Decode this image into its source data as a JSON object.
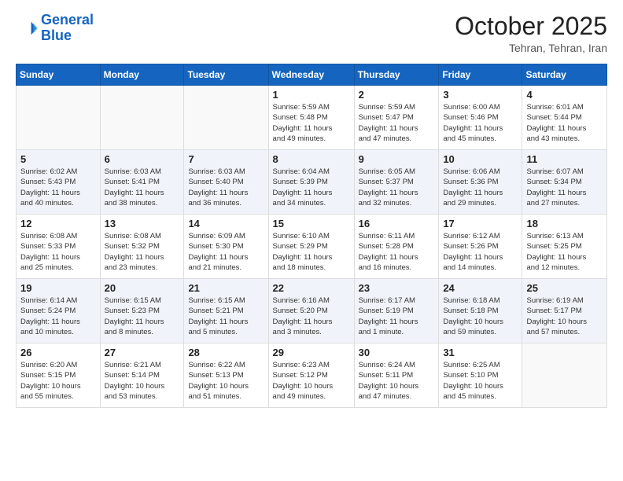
{
  "logo": {
    "line1": "General",
    "line2": "Blue"
  },
  "title": "October 2025",
  "location": "Tehran, Tehran, Iran",
  "weekdays": [
    "Sunday",
    "Monday",
    "Tuesday",
    "Wednesday",
    "Thursday",
    "Friday",
    "Saturday"
  ],
  "weeks": [
    [
      {
        "day": "",
        "info": ""
      },
      {
        "day": "",
        "info": ""
      },
      {
        "day": "",
        "info": ""
      },
      {
        "day": "1",
        "info": "Sunrise: 5:59 AM\nSunset: 5:48 PM\nDaylight: 11 hours\nand 49 minutes."
      },
      {
        "day": "2",
        "info": "Sunrise: 5:59 AM\nSunset: 5:47 PM\nDaylight: 11 hours\nand 47 minutes."
      },
      {
        "day": "3",
        "info": "Sunrise: 6:00 AM\nSunset: 5:46 PM\nDaylight: 11 hours\nand 45 minutes."
      },
      {
        "day": "4",
        "info": "Sunrise: 6:01 AM\nSunset: 5:44 PM\nDaylight: 11 hours\nand 43 minutes."
      }
    ],
    [
      {
        "day": "5",
        "info": "Sunrise: 6:02 AM\nSunset: 5:43 PM\nDaylight: 11 hours\nand 40 minutes."
      },
      {
        "day": "6",
        "info": "Sunrise: 6:03 AM\nSunset: 5:41 PM\nDaylight: 11 hours\nand 38 minutes."
      },
      {
        "day": "7",
        "info": "Sunrise: 6:03 AM\nSunset: 5:40 PM\nDaylight: 11 hours\nand 36 minutes."
      },
      {
        "day": "8",
        "info": "Sunrise: 6:04 AM\nSunset: 5:39 PM\nDaylight: 11 hours\nand 34 minutes."
      },
      {
        "day": "9",
        "info": "Sunrise: 6:05 AM\nSunset: 5:37 PM\nDaylight: 11 hours\nand 32 minutes."
      },
      {
        "day": "10",
        "info": "Sunrise: 6:06 AM\nSunset: 5:36 PM\nDaylight: 11 hours\nand 29 minutes."
      },
      {
        "day": "11",
        "info": "Sunrise: 6:07 AM\nSunset: 5:34 PM\nDaylight: 11 hours\nand 27 minutes."
      }
    ],
    [
      {
        "day": "12",
        "info": "Sunrise: 6:08 AM\nSunset: 5:33 PM\nDaylight: 11 hours\nand 25 minutes."
      },
      {
        "day": "13",
        "info": "Sunrise: 6:08 AM\nSunset: 5:32 PM\nDaylight: 11 hours\nand 23 minutes."
      },
      {
        "day": "14",
        "info": "Sunrise: 6:09 AM\nSunset: 5:30 PM\nDaylight: 11 hours\nand 21 minutes."
      },
      {
        "day": "15",
        "info": "Sunrise: 6:10 AM\nSunset: 5:29 PM\nDaylight: 11 hours\nand 18 minutes."
      },
      {
        "day": "16",
        "info": "Sunrise: 6:11 AM\nSunset: 5:28 PM\nDaylight: 11 hours\nand 16 minutes."
      },
      {
        "day": "17",
        "info": "Sunrise: 6:12 AM\nSunset: 5:26 PM\nDaylight: 11 hours\nand 14 minutes."
      },
      {
        "day": "18",
        "info": "Sunrise: 6:13 AM\nSunset: 5:25 PM\nDaylight: 11 hours\nand 12 minutes."
      }
    ],
    [
      {
        "day": "19",
        "info": "Sunrise: 6:14 AM\nSunset: 5:24 PM\nDaylight: 11 hours\nand 10 minutes."
      },
      {
        "day": "20",
        "info": "Sunrise: 6:15 AM\nSunset: 5:23 PM\nDaylight: 11 hours\nand 8 minutes."
      },
      {
        "day": "21",
        "info": "Sunrise: 6:15 AM\nSunset: 5:21 PM\nDaylight: 11 hours\nand 5 minutes."
      },
      {
        "day": "22",
        "info": "Sunrise: 6:16 AM\nSunset: 5:20 PM\nDaylight: 11 hours\nand 3 minutes."
      },
      {
        "day": "23",
        "info": "Sunrise: 6:17 AM\nSunset: 5:19 PM\nDaylight: 11 hours\nand 1 minute."
      },
      {
        "day": "24",
        "info": "Sunrise: 6:18 AM\nSunset: 5:18 PM\nDaylight: 10 hours\nand 59 minutes."
      },
      {
        "day": "25",
        "info": "Sunrise: 6:19 AM\nSunset: 5:17 PM\nDaylight: 10 hours\nand 57 minutes."
      }
    ],
    [
      {
        "day": "26",
        "info": "Sunrise: 6:20 AM\nSunset: 5:15 PM\nDaylight: 10 hours\nand 55 minutes."
      },
      {
        "day": "27",
        "info": "Sunrise: 6:21 AM\nSunset: 5:14 PM\nDaylight: 10 hours\nand 53 minutes."
      },
      {
        "day": "28",
        "info": "Sunrise: 6:22 AM\nSunset: 5:13 PM\nDaylight: 10 hours\nand 51 minutes."
      },
      {
        "day": "29",
        "info": "Sunrise: 6:23 AM\nSunset: 5:12 PM\nDaylight: 10 hours\nand 49 minutes."
      },
      {
        "day": "30",
        "info": "Sunrise: 6:24 AM\nSunset: 5:11 PM\nDaylight: 10 hours\nand 47 minutes."
      },
      {
        "day": "31",
        "info": "Sunrise: 6:25 AM\nSunset: 5:10 PM\nDaylight: 10 hours\nand 45 minutes."
      },
      {
        "day": "",
        "info": ""
      }
    ]
  ]
}
